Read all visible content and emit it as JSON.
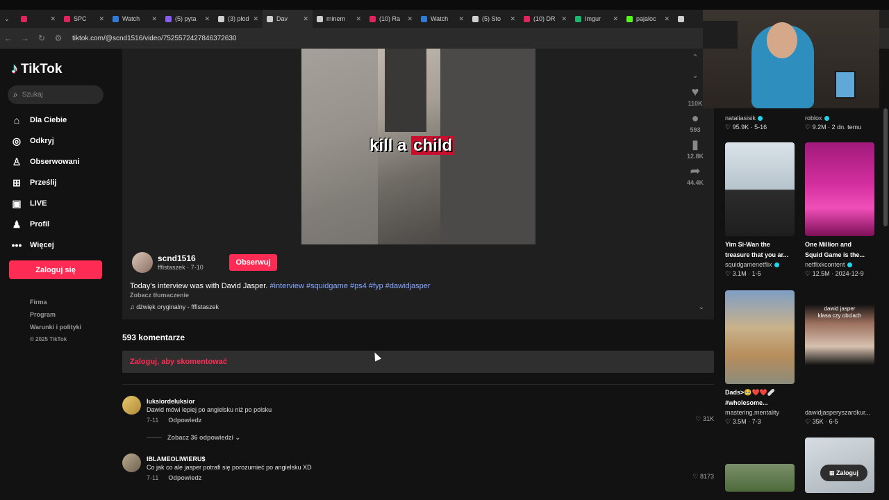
{
  "browser": {
    "tabs": [
      {
        "label": "",
        "color": "#e0245e"
      },
      {
        "label": "SPC",
        "color": "#e0245e"
      },
      {
        "label": "Watch",
        "color": "#2f7bd9"
      },
      {
        "label": "(5) pyta",
        "color": "#8a5cf6"
      },
      {
        "label": "(3) płod",
        "color": "#cfcfcf"
      },
      {
        "label": "Dav",
        "color": "#cfcfcf"
      },
      {
        "label": "minem",
        "color": "#cfcfcf"
      },
      {
        "label": "(10) Ra",
        "color": "#e0245e"
      },
      {
        "label": "Watch",
        "color": "#2f7bd9"
      },
      {
        "label": "(5) Sto",
        "color": "#cfcfcf"
      },
      {
        "label": "(10) DR",
        "color": "#e0245e"
      },
      {
        "label": "Imgur",
        "color": "#1bb76e"
      },
      {
        "label": "pajaloc",
        "color": "#53fc18"
      },
      {
        "label": "",
        "color": "#cfcfcf"
      }
    ],
    "url": "tiktok.com/@scnd1516/video/7525572427846372630"
  },
  "sidebar": {
    "logo": "TikTok",
    "search_placeholder": "Szukaj",
    "items": [
      {
        "label": "Dla Ciebie",
        "icon": "⌂",
        "name": "home"
      },
      {
        "label": "Odkryj",
        "icon": "◎",
        "name": "explore"
      },
      {
        "label": "Obserwowani",
        "icon": "♙",
        "name": "following"
      },
      {
        "label": "Prześlij",
        "icon": "⊞",
        "name": "upload"
      },
      {
        "label": "LIVE",
        "icon": "▣",
        "name": "live"
      },
      {
        "label": "Profil",
        "icon": "♟",
        "name": "profile"
      },
      {
        "label": "Więcej",
        "icon": "•••",
        "name": "more"
      }
    ],
    "login_button": "Zaloguj się",
    "footer": [
      "Firma",
      "Program",
      "Warunki i polityki",
      "© 2025 TikTok"
    ]
  },
  "video": {
    "caption_white": "kill a",
    "caption_red": "child",
    "actions": [
      {
        "icon": "♥",
        "count": "110K",
        "name": "like"
      },
      {
        "icon": "●",
        "count": "593",
        "name": "comment"
      },
      {
        "icon": "▮",
        "count": "12.8K",
        "name": "bookmark"
      },
      {
        "icon": "➦",
        "count": "44.4K",
        "name": "share"
      }
    ]
  },
  "author": {
    "username": "scnd1516",
    "sub": "fffistaszek · 7-10",
    "follow": "Obserwuj",
    "description": "Today's interview was with David Jasper.",
    "tags": "#interview #squidgame #ps4 #fyp #dawidjasper",
    "translate": "Zobacz tłumaczenie",
    "sound": "♫ dźwięk oryginalny - fffistaszek"
  },
  "comments": {
    "title": "593 komentarze",
    "login_prompt": "Zaloguj, aby skomentować",
    "items": [
      {
        "user": "luksiordeluksior",
        "text": "Dawid mówi lepiej po angielsku niż po polsku",
        "date": "7-11",
        "reply": "Odpowiedz",
        "likes": "31K",
        "replies": "Zobacz 36 odpowiedzi ⌄"
      },
      {
        "user": "IBLAMEOLIWIERU$",
        "text": "Co jak co ale jasper potrafi się porozumieć po angielsku XD",
        "date": "7-11",
        "reply": "Odpowiedz",
        "likes": "8173",
        "replies": ""
      }
    ]
  },
  "recommended": [
    {
      "title": "",
      "title2": "",
      "author": "nataliasisik",
      "verified": true,
      "stats": "♡ 95.9K · 5-16"
    },
    {
      "title": "",
      "title2": "",
      "author": "roblox",
      "verified": true,
      "stats": "♡ 9.2M · 2 dn. temu"
    },
    {
      "title": "Yim Si-Wan the",
      "title2": "treasure that you ar...",
      "author": "squidgamenetflix",
      "verified": true,
      "stats": "♡ 3.1M · 1-5"
    },
    {
      "title": "One Million and",
      "title2": "Squid Game is the...",
      "author": "netflixkcontent",
      "verified": true,
      "stats": "♡ 12.5M · 2024-12-9"
    },
    {
      "title": "Dads>🥹❤️❤️🩹",
      "title2": "#wholesome...",
      "author": "mastering.mentality",
      "verified": false,
      "stats": "♡ 3.5M · 7-3"
    },
    {
      "title": "",
      "title2": "",
      "author": "dawidjasperyszardkur...",
      "verified": false,
      "stats": "♡ 35K · 6-5"
    }
  ],
  "thumb_texts": {
    "card6_line1": "dawid jasper",
    "card6_line2": "klasa czy obciach"
  },
  "floating_login": "Zaloguj",
  "colors": {
    "brand": "#fe2c55",
    "hashtag": "#88a8ff",
    "verified": "#20d5ec"
  }
}
